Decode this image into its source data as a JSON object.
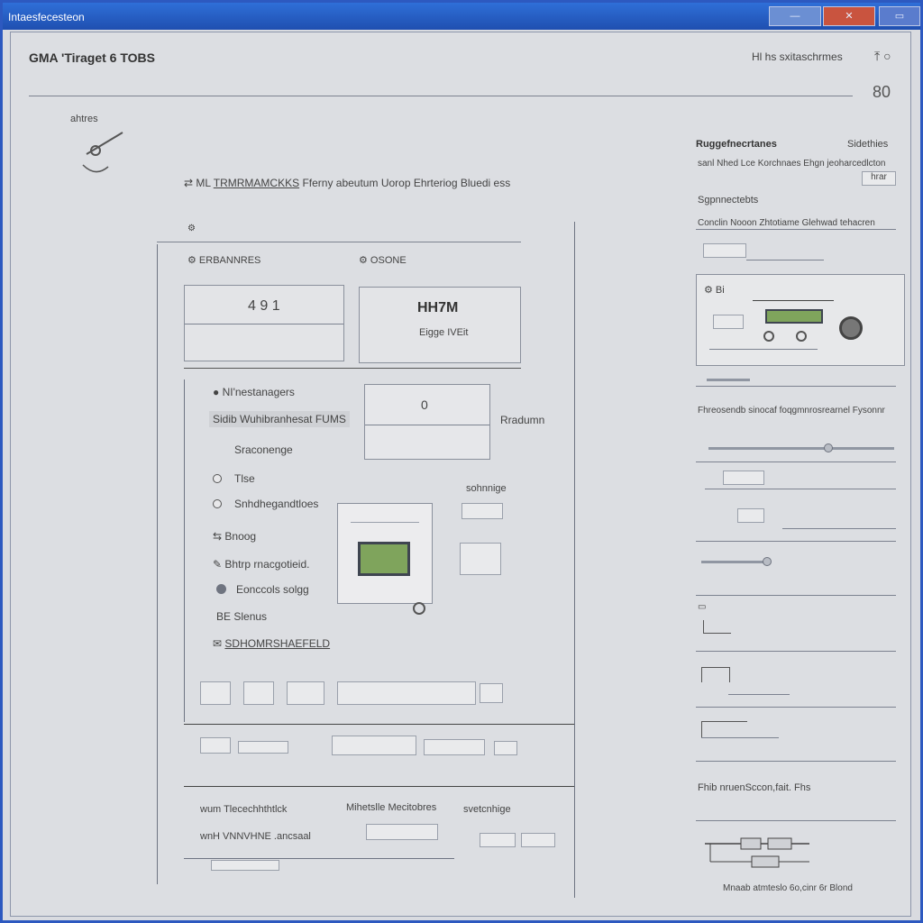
{
  "window": {
    "title": "Intaesfecesteon"
  },
  "header": {
    "title": "GMA 'Tiraget 6 TOBS",
    "right_text": "Hl hs sxitaschrmes",
    "right_icon_glyph": "⤒ ○",
    "zoom": "80"
  },
  "left_panel": {
    "label": "ahtres"
  },
  "center": {
    "heading_prefix": "ML",
    "heading_link": "TRMRMAMCKKS",
    "heading_rest": "Fferny abeutum Uorop Ehrteriog Bluedi ess",
    "card_left_label": "ERBANNRES",
    "card_right_label": "OSONE",
    "card_left_value": "4 9 1",
    "card_right_value": "HH7M",
    "card_right_sub": "Eigge IVEit",
    "option_rows": [
      {
        "icon": "●",
        "label": "NI'nestanagers"
      },
      {
        "icon": "▭",
        "label": "Sidib Wuhibranhesat FUMS"
      },
      {
        "icon": "",
        "label": "Sraconenge"
      },
      {
        "icon": "○",
        "label": "Tlse"
      },
      {
        "icon": "○",
        "label": "Snhdhegandtloes"
      },
      {
        "icon": "⇆",
        "label": "Bnoog"
      },
      {
        "icon": "✎",
        "label": "Bhtrp rnacgotieid."
      },
      {
        "icon": "●",
        "label": "Eonccols solgg"
      },
      {
        "icon": "BE",
        "label": "Slenus"
      },
      {
        "icon": "✉",
        "label": "SDHOMRSHAEFELD"
      }
    ],
    "preview_value": "0",
    "preview_side_label": "Rradumn",
    "callout_label": "sohnnige",
    "bottom_labels": {
      "a": "wum Tlecechhthtlck",
      "b": "Mihetslle Mecitobres",
      "c": "svetcnhige",
      "d": "wnH VNNVHNE .ancsaal"
    }
  },
  "right_panel": {
    "title_left": "Ruggefnecrtanes",
    "title_right": "Sidethies",
    "desc": "sanl Nhed Lce Korchnaes Ehgn jeoharcedlcton",
    "small_button": "hrar",
    "section_label": "Sgpnnectebts",
    "section_desc": "Conclin Nooon Zhtotiame Glehwad tehacren",
    "device_label": "Bi",
    "settings_desc": "Fhreosendb sinocaf foqgmnrosrearnel Fysonnr",
    "footer_text": "Fhib nruenSccon,fait. Fhs",
    "bottom_caption": "Mnaab atmteslo 6o,cinr 6r Blond"
  },
  "colors": {
    "titlebar": "#1f4fb0",
    "lcd": "#7fa45c",
    "close": "#c9543f"
  }
}
